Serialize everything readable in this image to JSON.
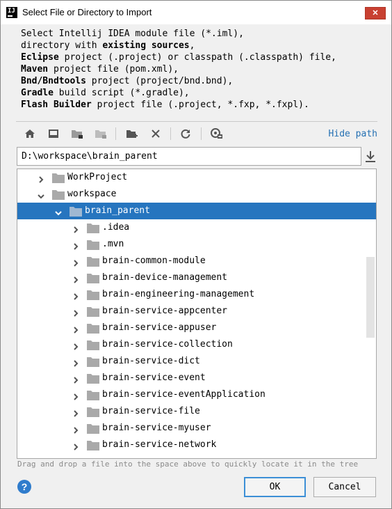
{
  "window": {
    "title": "Select File or Directory to Import",
    "app_icon_text": "IJ",
    "close_glyph": "✕"
  },
  "description": [
    [
      {
        "t": "Select Intellij IDEA module file (*.iml),",
        "b": false
      }
    ],
    [
      {
        "t": "directory with ",
        "b": false
      },
      {
        "t": "existing sources",
        "b": true
      },
      {
        "t": ",",
        "b": false
      }
    ],
    [
      {
        "t": "Eclipse",
        "b": true
      },
      {
        "t": " project (.project) or classpath (.classpath) file,",
        "b": false
      }
    ],
    [
      {
        "t": "Maven",
        "b": true
      },
      {
        "t": " project file (pom.xml),",
        "b": false
      }
    ],
    [
      {
        "t": "Bnd/Bndtools",
        "b": true
      },
      {
        "t": " project (project/bnd.bnd),",
        "b": false
      }
    ],
    [
      {
        "t": "Gradle",
        "b": true
      },
      {
        "t": " build script (*.gradle),",
        "b": false
      }
    ],
    [
      {
        "t": "Flash Builder",
        "b": true
      },
      {
        "t": " project file (.project, *.fxp, *.fxpl).",
        "b": false
      }
    ]
  ],
  "toolbar": {
    "icons": [
      "home-icon",
      "desktop-icon",
      "project-folder-icon",
      "module-folder-icon",
      "new-folder-icon",
      "delete-icon",
      "refresh-icon",
      "show-hidden-icon"
    ],
    "hide_path": "Hide path"
  },
  "path": {
    "value": "D:\\workspace\\brain_parent"
  },
  "tree": {
    "selected_color": "#2675bf",
    "items": [
      {
        "label": "WorkProject",
        "depth": 0,
        "expanded": false,
        "selected": false
      },
      {
        "label": "workspace",
        "depth": 0,
        "expanded": true,
        "selected": false
      },
      {
        "label": "brain_parent",
        "depth": 1,
        "expanded": true,
        "selected": true
      },
      {
        "label": ".idea",
        "depth": 2,
        "expanded": false,
        "selected": false
      },
      {
        "label": ".mvn",
        "depth": 2,
        "expanded": false,
        "selected": false
      },
      {
        "label": "brain-common-module",
        "depth": 2,
        "expanded": false,
        "selected": false
      },
      {
        "label": "brain-device-management",
        "depth": 2,
        "expanded": false,
        "selected": false
      },
      {
        "label": "brain-engineering-management",
        "depth": 2,
        "expanded": false,
        "selected": false
      },
      {
        "label": "brain-service-appcenter",
        "depth": 2,
        "expanded": false,
        "selected": false
      },
      {
        "label": "brain-service-appuser",
        "depth": 2,
        "expanded": false,
        "selected": false
      },
      {
        "label": "brain-service-collection",
        "depth": 2,
        "expanded": false,
        "selected": false
      },
      {
        "label": "brain-service-dict",
        "depth": 2,
        "expanded": false,
        "selected": false
      },
      {
        "label": "brain-service-event",
        "depth": 2,
        "expanded": false,
        "selected": false
      },
      {
        "label": "brain-service-eventApplication",
        "depth": 2,
        "expanded": false,
        "selected": false
      },
      {
        "label": "brain-service-file",
        "depth": 2,
        "expanded": false,
        "selected": false
      },
      {
        "label": "brain-service-myuser",
        "depth": 2,
        "expanded": false,
        "selected": false
      },
      {
        "label": "brain-service-network",
        "depth": 2,
        "expanded": false,
        "selected": false
      }
    ]
  },
  "hint": "Drag and drop a file into the space above to quickly locate it in the tree",
  "footer": {
    "help": "?",
    "ok": "OK",
    "cancel": "Cancel"
  }
}
